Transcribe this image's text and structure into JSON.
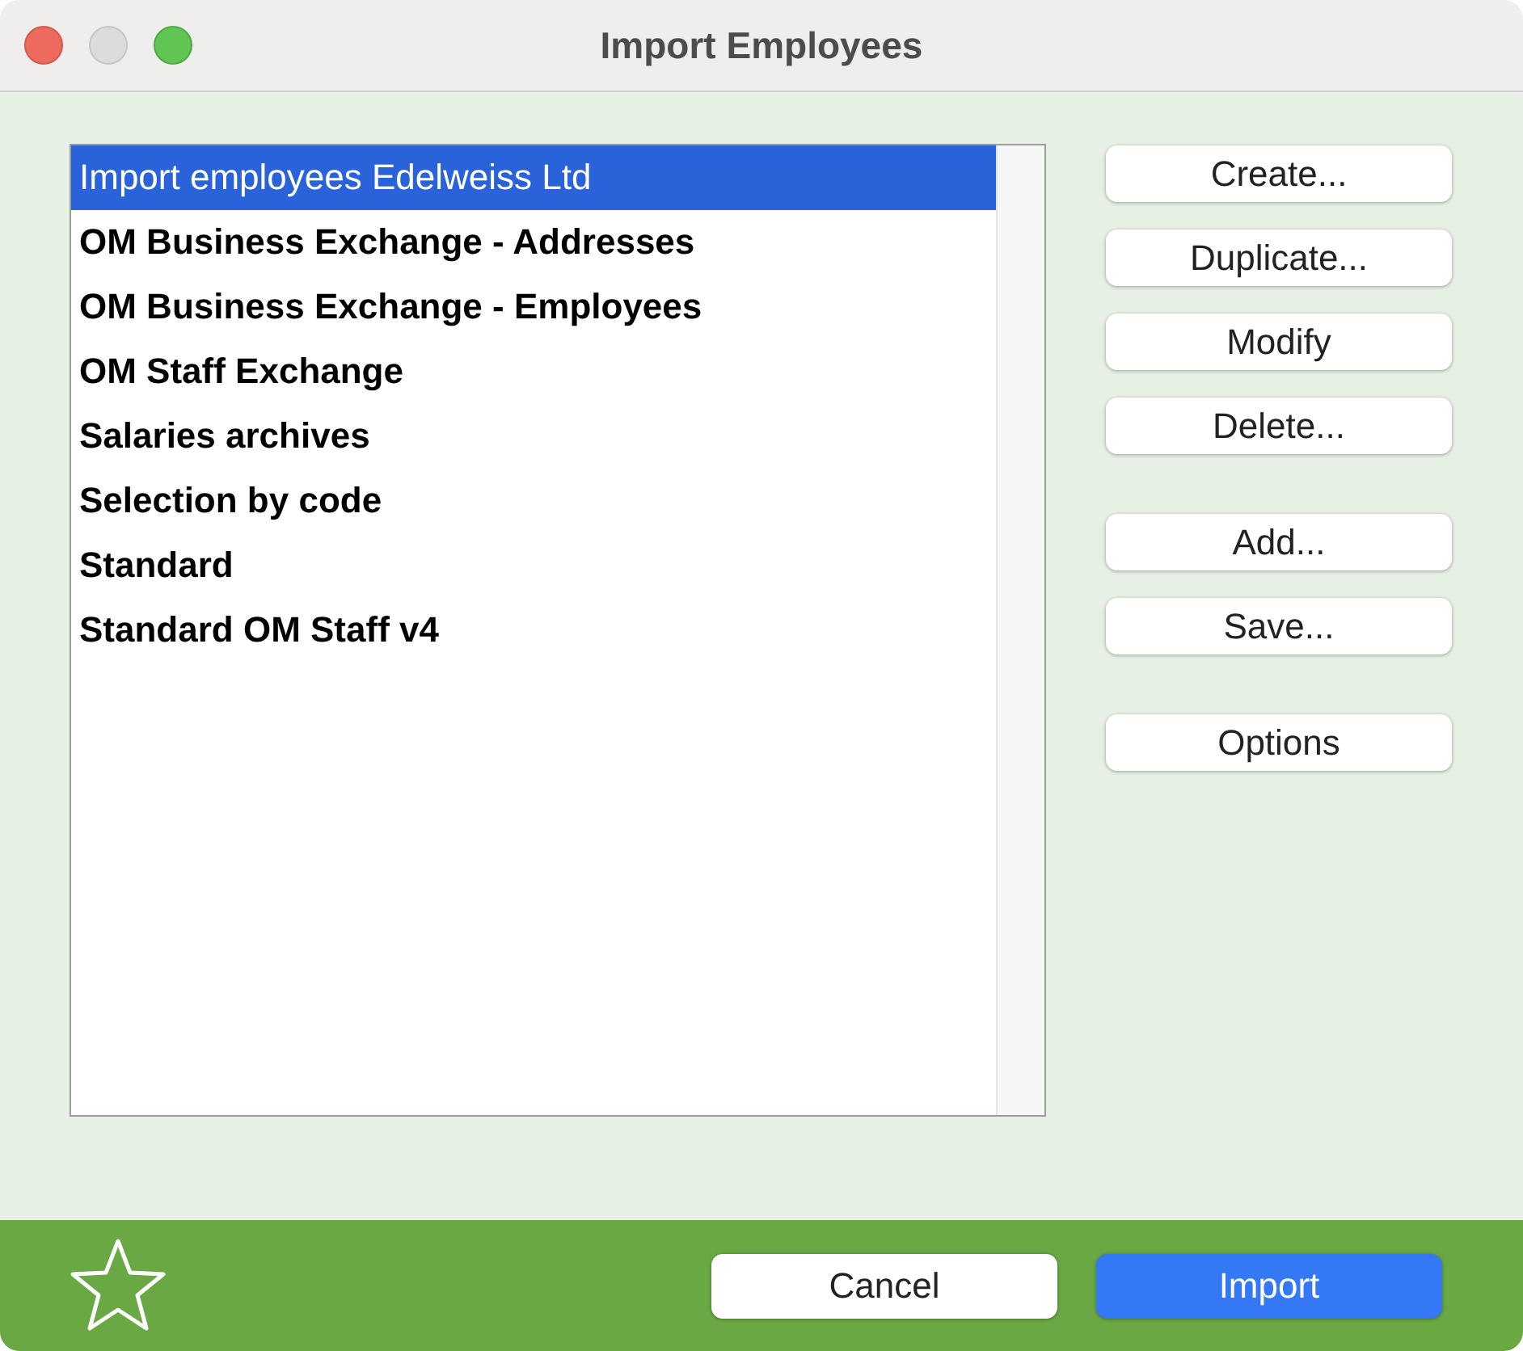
{
  "window": {
    "title": "Import Employees"
  },
  "import_list": {
    "items": [
      {
        "label": "Import employees Edelweiss Ltd",
        "selected": true
      },
      {
        "label": "OM Business Exchange - Addresses",
        "selected": false
      },
      {
        "label": "OM Business Exchange - Employees",
        "selected": false
      },
      {
        "label": "OM Staff Exchange",
        "selected": false
      },
      {
        "label": "Salaries archives",
        "selected": false
      },
      {
        "label": "Selection by code",
        "selected": false
      },
      {
        "label": "Standard",
        "selected": false
      },
      {
        "label": "Standard OM Staff v4",
        "selected": false
      }
    ]
  },
  "button_groups": [
    [
      "Create...",
      "Duplicate...",
      "Modify",
      "Delete..."
    ],
    [
      "Add...",
      "Save..."
    ],
    [
      "Options"
    ]
  ],
  "footer_buttons": [
    {
      "label": "Cancel",
      "kind": "plain"
    },
    {
      "label": "Import",
      "kind": "primary"
    }
  ]
}
